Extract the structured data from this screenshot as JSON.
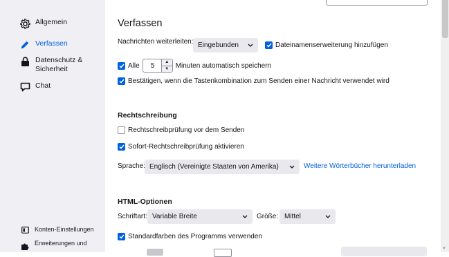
{
  "sidebar": {
    "items": [
      {
        "label": "Allgemein",
        "icon": "gear-icon"
      },
      {
        "label": "Verfassen",
        "icon": "pencil-icon"
      },
      {
        "label": "Datenschutz &",
        "label2": "Sicherheit",
        "icon": "lock-icon"
      },
      {
        "label": "Chat",
        "icon": "chat-icon"
      }
    ],
    "bottom": [
      {
        "label": "Konten-Einstellungen",
        "icon": "account-icon"
      },
      {
        "label": "Erweiterungen und",
        "icon": "puzzle-icon"
      }
    ]
  },
  "compose": {
    "title": "Verfassen",
    "forward_label": "Nachrichten weiterleiten:",
    "forward_value": "Eingebunden",
    "attach_ext_label": "Dateinamenserweiterung hinzufügen",
    "autosave_label": "Alle",
    "autosave_value": "5",
    "autosave_suffix": "Minuten automatisch speichern",
    "confirm_label": "Bestätigen, wenn die Tastenkombination zum Senden einer Nachricht verwendet wird"
  },
  "spelling": {
    "title": "Rechtschreibung",
    "check_before_send": "Rechtschreibprüfung vor dem Senden",
    "inline_check": "Sofort-Rechtschreibprüfung aktivieren",
    "language_label": "Sprache:",
    "language_value": "Englisch (Vereinigte Staaten von Amerika)",
    "more_dicts": "Weitere Wörterbücher herunterladen"
  },
  "html_options": {
    "title": "HTML-Optionen",
    "font_label": "Schriftart:",
    "font_value": "Variable Breite",
    "size_label": "Größe:",
    "size_value": "Mittel",
    "default_colors": "Standardfarben des Programms verwenden"
  },
  "colors": {
    "accent": "#0061e0",
    "sidebar_bg": "#f0f0f4",
    "select_bg": "#e9e9ed"
  }
}
